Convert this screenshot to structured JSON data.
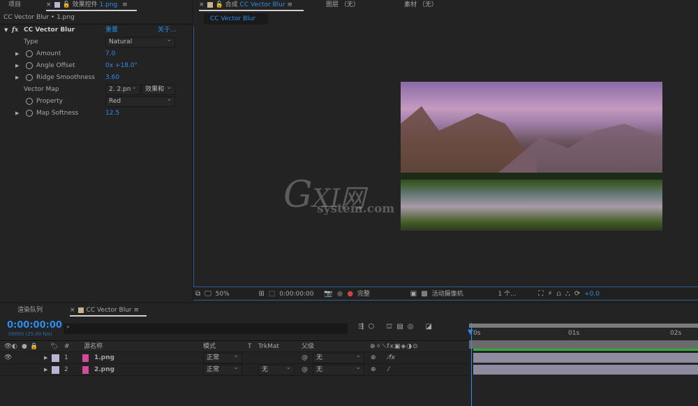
{
  "project_tab": "项目",
  "effects_panel": {
    "tab_prefix": "效果控件",
    "tab_file": "1.png",
    "subtitle": "CC Vector Blur • 1.png",
    "effect_name": "CC Vector Blur",
    "reset": "重置",
    "about": "关于...",
    "props": [
      {
        "label": "Type",
        "value": "Natural",
        "kind": "dropdown"
      },
      {
        "label": "Amount",
        "value": "7.0",
        "kind": "number"
      },
      {
        "label": "Angle Offset",
        "value": "0x +18.0°",
        "kind": "number"
      },
      {
        "label": "Ridge Smoothness",
        "value": "3.60",
        "kind": "number"
      },
      {
        "label": "Vector Map",
        "value": "2. 2.pn",
        "value2": "效果和",
        "kind": "dropdown2"
      },
      {
        "label": "Property",
        "value": "Red",
        "kind": "dropdown"
      },
      {
        "label": "Map Softness",
        "value": "12.5",
        "kind": "number"
      }
    ]
  },
  "comp_panel": {
    "tab_prefix": "合成",
    "tab_name": "CC Vector Blur",
    "layer_tab": "图层 （无）",
    "footage_tab": "素材 （无）",
    "subtab": "CC Vector Blur",
    "watermark": "GXI网 system.com",
    "toolbar": {
      "zoom": "50%",
      "time": "0:00:00:00",
      "resolution": "完整",
      "camera": "活动摄像机",
      "views": "1 个...",
      "exposure": "+0.0"
    }
  },
  "timeline": {
    "render_tab": "渲染队列",
    "comp_tab": "CC Vector Blur",
    "timecode": "0:00:00:00",
    "fps": "00000 (25.00 fps)",
    "search_placeholder": "",
    "headers": {
      "num": "#",
      "source": "源名称",
      "mode": "模式",
      "t": "T",
      "trkmat": "TrkMat",
      "parent": "父级"
    },
    "ruler": [
      "0s",
      "01s",
      "02s"
    ],
    "layers": [
      {
        "num": "1",
        "name": "1.png",
        "mode": "正常",
        "trkmat": "",
        "parent": "无",
        "fx": true
      },
      {
        "num": "2",
        "name": "2.png",
        "mode": "正常",
        "trkmat": "无",
        "parent": "无",
        "fx": false
      }
    ]
  },
  "colors": {
    "accent": "#2d8ceb",
    "label_color": "#b9b4d6",
    "work_area": "#2fae3a"
  }
}
